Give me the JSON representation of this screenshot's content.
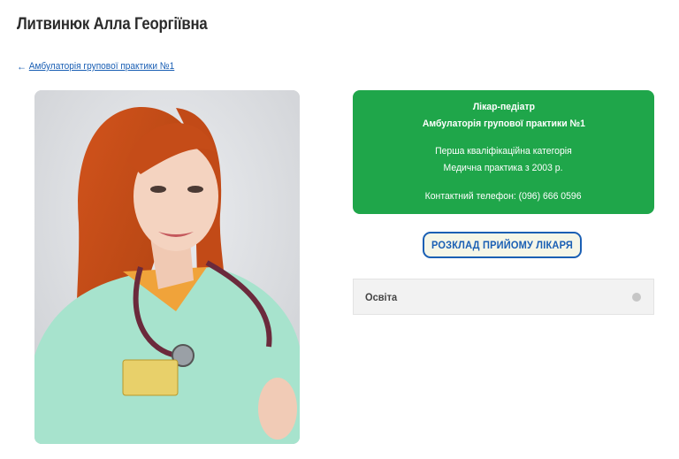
{
  "page": {
    "title": "Литвинюк Алла Георгіївна"
  },
  "breadcrumb": {
    "arrow": "←",
    "link_label": "Амбулаторія групової практики №1"
  },
  "doctor_card": {
    "specialty": "Лікар-педіатр",
    "clinic": "Амбулаторія групової практики №1",
    "category": "Перша кваліфікаційна категорія",
    "practice": "Медична практика з 2003 р.",
    "phone": "Контактний телефон: (096) 666 0596"
  },
  "actions": {
    "schedule_label": "РОЗКЛАД ПРИЙОМУ ЛІКАРЯ"
  },
  "accordion": {
    "education_label": "Освіта",
    "icon": "circle-toggle-icon"
  },
  "colors": {
    "card_green": "#1fa64a",
    "link_blue": "#1a5fb4",
    "accordion_bg": "#f2f2f2"
  }
}
